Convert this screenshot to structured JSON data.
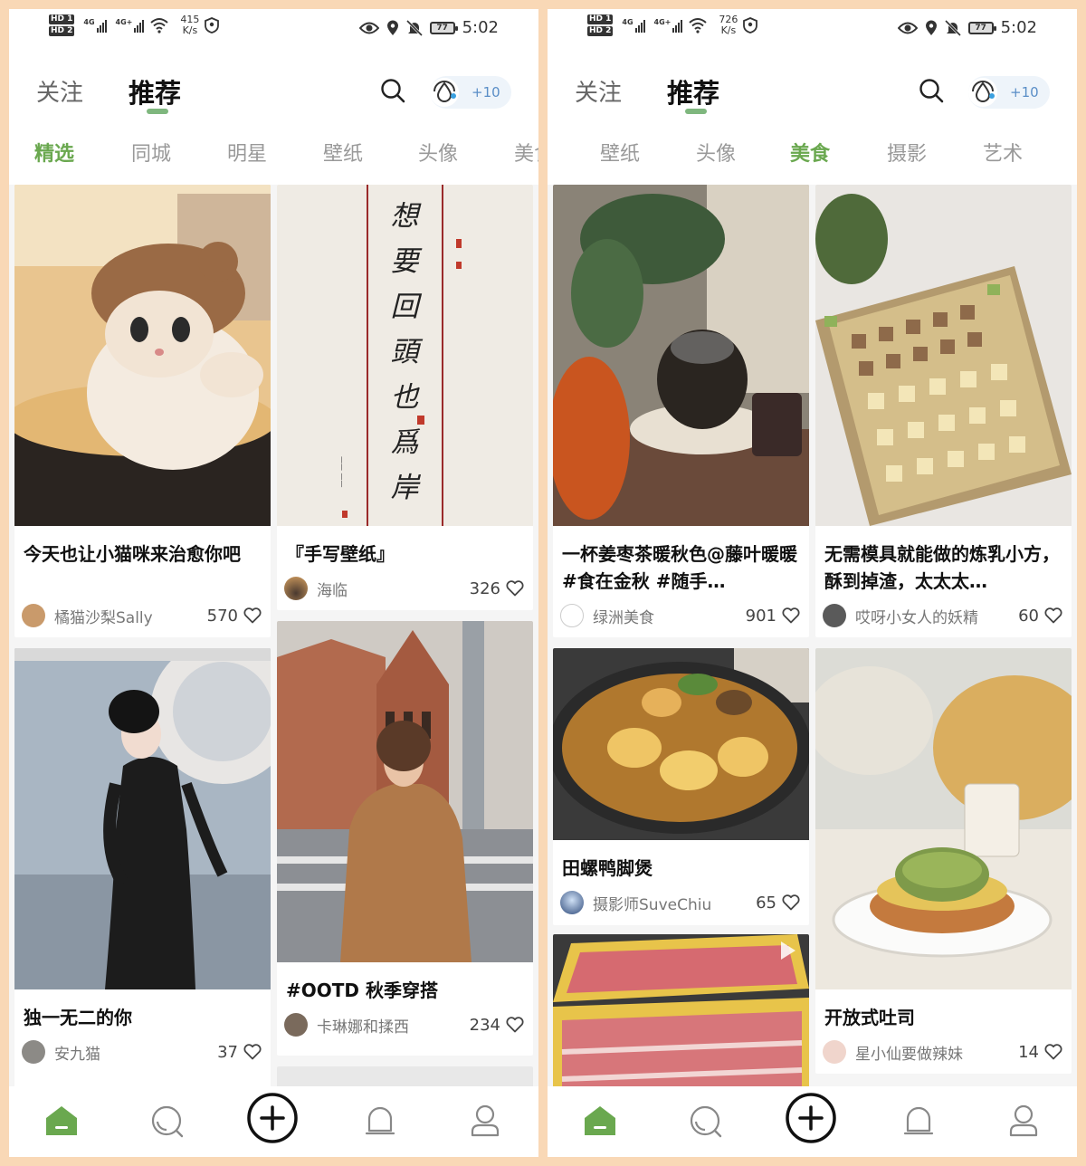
{
  "status_bar": {
    "left_speed_value": "415",
    "right_speed_value": "726",
    "speed_unit": "K/s",
    "battery": "77",
    "time": "5:02",
    "hd1": "HD 1",
    "hd2": "HD 2",
    "net1": "4G",
    "net2": "4G+"
  },
  "top_nav": {
    "follow_tab": "关注",
    "recommend_tab": "推荐",
    "drop_count": "+10"
  },
  "left_screen": {
    "categories": [
      {
        "label": "精选",
        "active": true
      },
      {
        "label": "同城",
        "active": false
      },
      {
        "label": "明星",
        "active": false
      },
      {
        "label": "壁纸",
        "active": false
      },
      {
        "label": "头像",
        "active": false
      },
      {
        "label": "美食",
        "active": false
      }
    ],
    "cards": [
      {
        "title": "今天也让小猫咪来治愈你吧",
        "author": "橘猫沙梨Sally",
        "likes": "570"
      },
      {
        "title": "『手写壁纸』",
        "author": "海临",
        "likes": "326"
      },
      {
        "title": "独一无二的你",
        "author": "安九猫",
        "likes": "37"
      },
      {
        "title": "#OOTD 秋季穿搭",
        "author": "卡琳娜和揉西",
        "likes": "234"
      }
    ],
    "calligraphy": "想要回頭也爲岸"
  },
  "right_screen": {
    "categories": [
      {
        "label": "壁纸",
        "active": false
      },
      {
        "label": "头像",
        "active": false
      },
      {
        "label": "美食",
        "active": true
      },
      {
        "label": "摄影",
        "active": false
      },
      {
        "label": "艺术",
        "active": false
      }
    ],
    "cards": [
      {
        "title": "一杯姜枣茶暖秋色@藤叶暖暖 #食在金秋 #随手…",
        "author": "绿洲美食",
        "likes": "901"
      },
      {
        "title": "无需模具就能做的炼乳小方，酥到掉渣，太太太…",
        "author": "哎呀小女人的妖精",
        "likes": "60"
      },
      {
        "title": "田螺鸭脚煲",
        "author": "摄影师SuveChiu",
        "likes": "65"
      },
      {
        "title": "开放式吐司",
        "author": "星小仙要做辣妹",
        "likes": "14"
      }
    ]
  },
  "bottom_nav": [
    "home-icon",
    "discover-icon",
    "add-icon",
    "notification-icon",
    "profile-icon"
  ],
  "colors": {
    "accent": "#6aa84f",
    "frame": "#f9d8b6"
  }
}
